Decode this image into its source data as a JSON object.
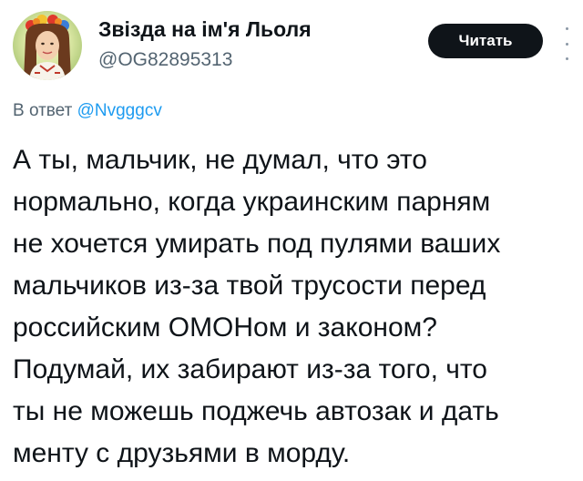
{
  "user": {
    "display_name": "Звізда на ім'я Льоля",
    "handle": "@OG82895313"
  },
  "follow_button": {
    "label": "Читать"
  },
  "reply": {
    "prefix": "В ответ",
    "target": "@Nvgggcv"
  },
  "tweet": {
    "lines": [
      "А ты, мальчик, не думал, что это",
      "нормально, когда украинским парням",
      "не хочется умирать под пулями ваших",
      "мальчиков из-за твой трусости перед",
      "российским ОМОНом и законом?",
      "Подумай, их забирают из-за того, что",
      "ты не можешь поджечь автозак и дать",
      "менту с друзьями в морду."
    ]
  },
  "colors": {
    "text": "#0f1419",
    "muted": "#536471",
    "link": "#1d9bf0",
    "button_bg": "#0f1419",
    "button_text": "#ffffff"
  },
  "icons": [
    "avatar-image",
    "more-options-icon"
  ]
}
